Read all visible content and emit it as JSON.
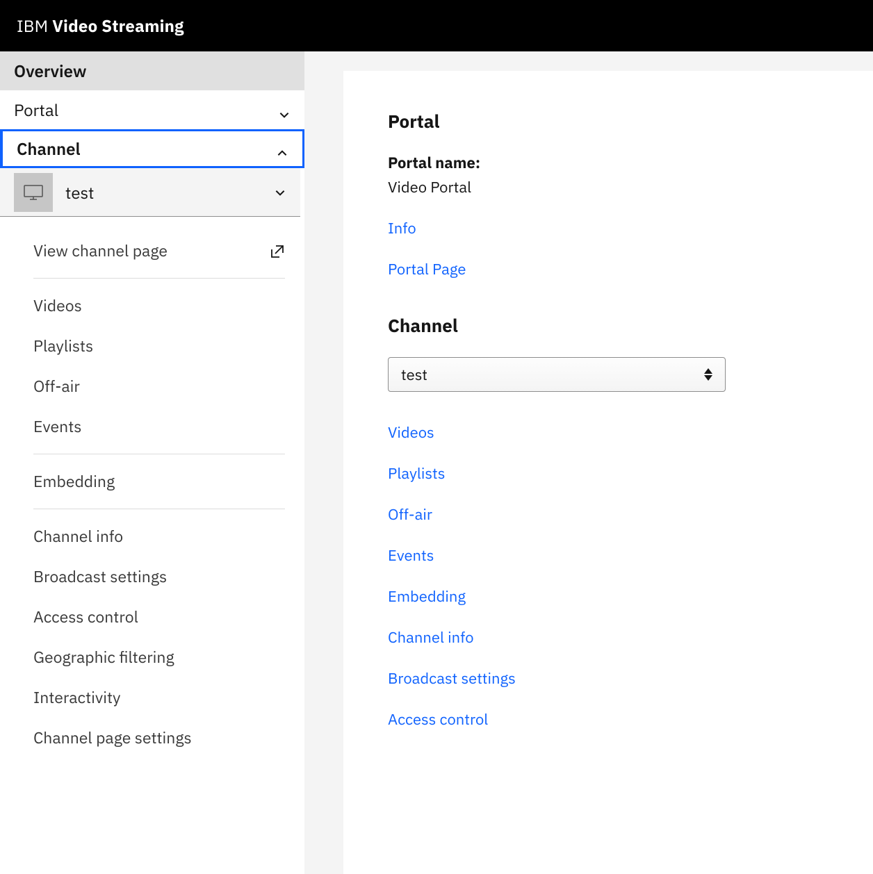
{
  "header": {
    "brand_prefix": "IBM ",
    "brand_bold": "Video Streaming"
  },
  "sidebar": {
    "overview": "Overview",
    "portal": "Portal",
    "channel": "Channel",
    "selected_channel": "test",
    "items": {
      "view_channel_page": "View channel page",
      "videos": "Videos",
      "playlists": "Playlists",
      "off_air": "Off-air",
      "events": "Events",
      "embedding": "Embedding",
      "channel_info": "Channel info",
      "broadcast_settings": "Broadcast settings",
      "access_control": "Access control",
      "geographic_filtering": "Geographic filtering",
      "interactivity": "Interactivity",
      "channel_page_settings": "Channel page settings"
    }
  },
  "main": {
    "portal_heading": "Portal",
    "portal_name_label": "Portal name:",
    "portal_name_value": "Video Portal",
    "link_info": "Info",
    "link_portal_page": "Portal Page",
    "channel_heading": "Channel",
    "channel_select_value": "test",
    "links": {
      "videos": "Videos",
      "playlists": "Playlists",
      "off_air": "Off-air",
      "events": "Events",
      "embedding": "Embedding",
      "channel_info": "Channel info",
      "broadcast_settings": "Broadcast settings",
      "access_control": "Access control"
    }
  }
}
